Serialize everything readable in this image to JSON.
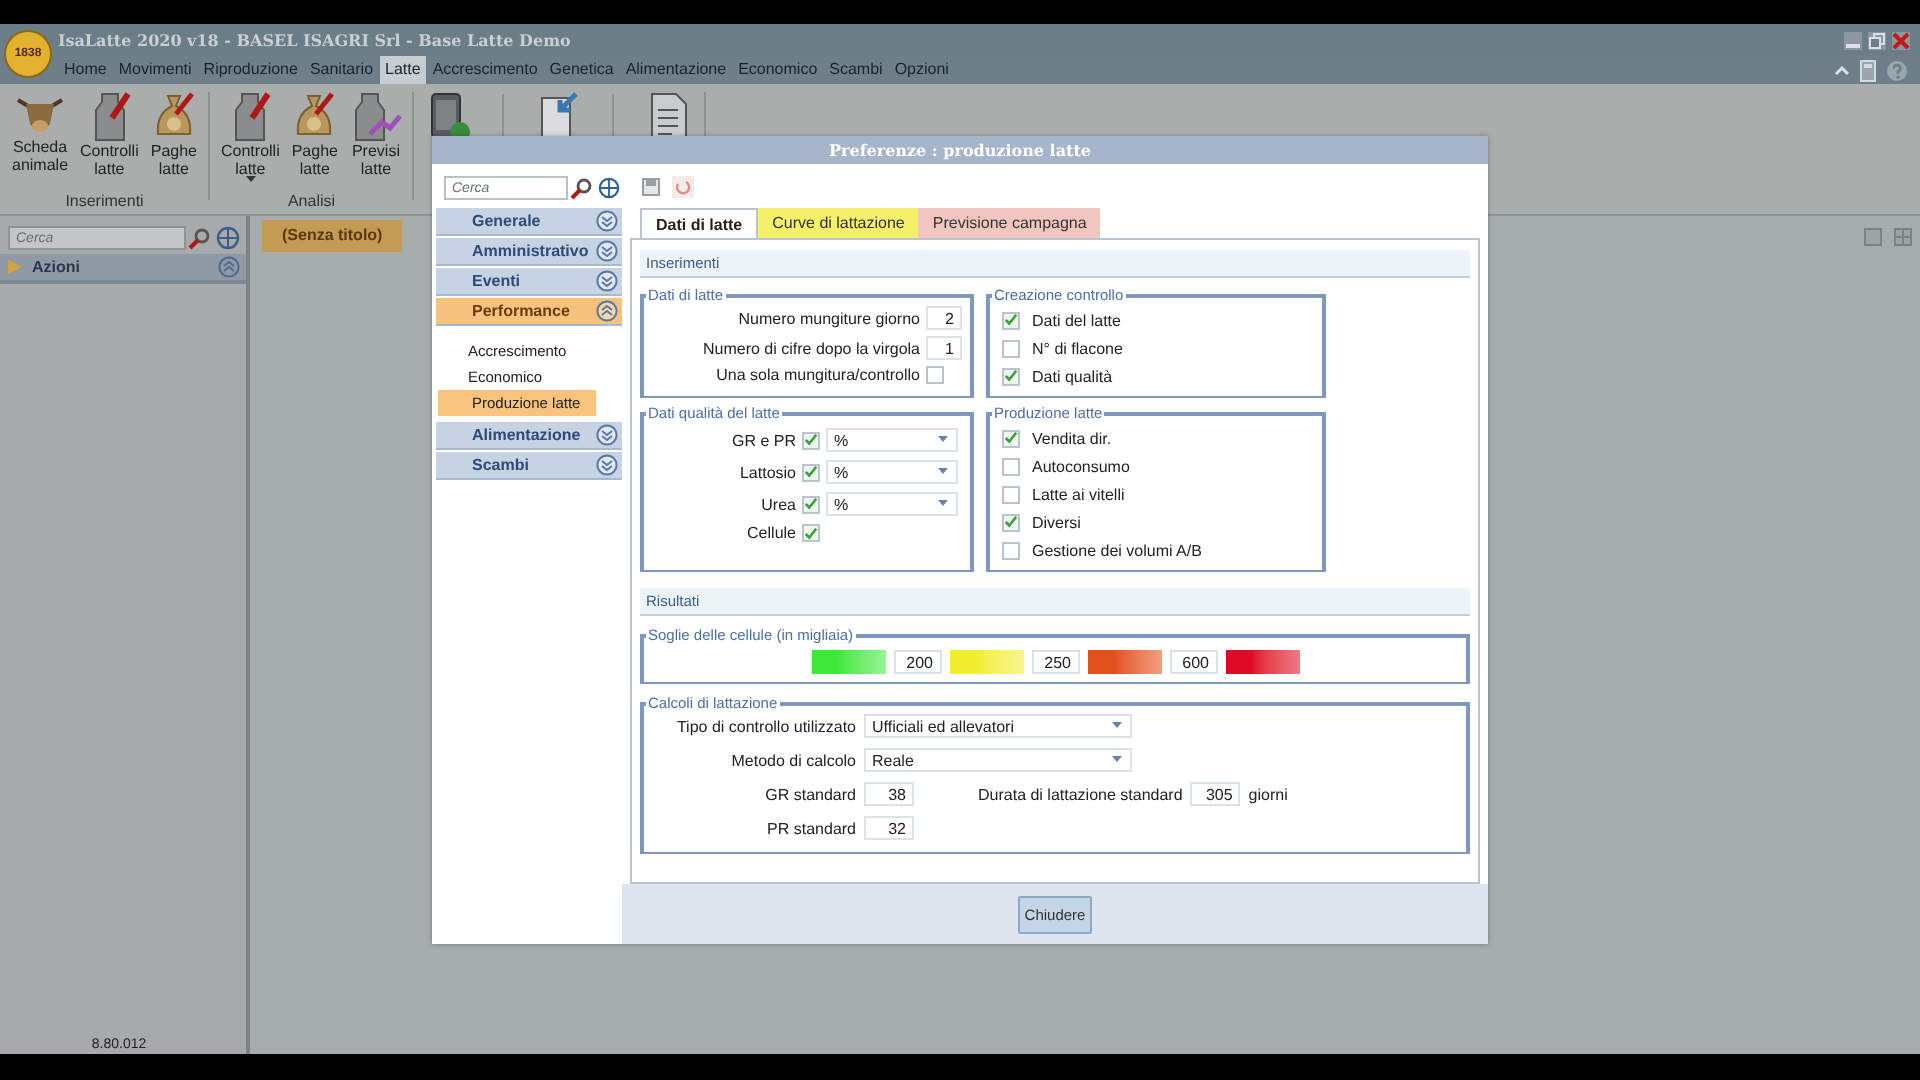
{
  "app": {
    "badge": "1838",
    "title": "IsaLatte 2020 v18 - BASEL ISAGRI Srl - Base Latte Demo"
  },
  "menu": [
    {
      "label": "Home",
      "selected": false
    },
    {
      "label": "Movimenti",
      "selected": false
    },
    {
      "label": "Riproduzione",
      "selected": false
    },
    {
      "label": "Sanitario",
      "selected": false
    },
    {
      "label": "Latte",
      "selected": true
    },
    {
      "label": "Accrescimento",
      "selected": false
    },
    {
      "label": "Genetica",
      "selected": false
    },
    {
      "label": "Alimentazione",
      "selected": false
    },
    {
      "label": "Economico",
      "selected": false
    },
    {
      "label": "Scambi",
      "selected": false
    },
    {
      "label": "Opzioni",
      "selected": false
    }
  ],
  "ribbon": [
    {
      "label": "Inserimenti",
      "buttons": [
        {
          "kind": "cow",
          "label": "Scheda animale"
        },
        {
          "kind": "milk-can",
          "label": "Controlli latte"
        },
        {
          "kind": "money-bag",
          "label": "Paghe latte"
        }
      ]
    },
    {
      "label": "Analisi",
      "buttons": [
        {
          "kind": "milk-can",
          "label": "Controlli latte",
          "dropdown": true
        },
        {
          "kind": "money-bag",
          "label": "Paghe latte"
        },
        {
          "kind": "forecast",
          "label": "Previsi latte"
        }
      ]
    },
    {
      "buttons": [
        {
          "kind": "tablet"
        },
        {
          "kind": "import"
        },
        {
          "kind": "document"
        }
      ]
    }
  ],
  "left_panel": {
    "search_placeholder": "Cerca",
    "section": "Azioni",
    "expanded": true,
    "version": "8.80.012"
  },
  "document_tab": "(Senza titolo)",
  "dialog": {
    "title": "Preferenze : produzione latte",
    "search_placeholder": "Cerca",
    "nav": [
      {
        "label": "Generale",
        "expanded": false,
        "selected": false
      },
      {
        "label": "Amministrativo",
        "expanded": false,
        "selected": false
      },
      {
        "label": "Eventi",
        "expanded": false,
        "selected": false
      },
      {
        "label": "Performance",
        "expanded": true,
        "selected": true,
        "children": [
          {
            "label": "Accrescimento",
            "selected": false
          },
          {
            "label": "Economico",
            "selected": false
          },
          {
            "label": "Produzione latte",
            "selected": true
          }
        ]
      },
      {
        "label": "Alimentazione",
        "expanded": false,
        "selected": false
      },
      {
        "label": "Scambi",
        "expanded": false,
        "selected": false
      }
    ],
    "tabs": [
      {
        "label": "Dati di latte",
        "selected": true,
        "color": "#ffffff"
      },
      {
        "label": "Curve di lattazione",
        "selected": false,
        "color": "#f4f06a"
      },
      {
        "label": "Previsione campagna",
        "selected": false,
        "color": "#f2c6bf"
      }
    ],
    "inserimenti": {
      "title": "Inserimenti",
      "dati_di_latte": {
        "legend": "Dati di latte",
        "fields": [
          {
            "kind": "number",
            "label": "Numero mungiture giorno",
            "value": "2"
          },
          {
            "kind": "number",
            "label": "Numero di cifre dopo la virgola",
            "value": "1"
          },
          {
            "kind": "checkbox",
            "label": "Una sola mungitura/controllo",
            "checked": false
          }
        ]
      },
      "creazione_controllo": {
        "legend": "Creazione controllo",
        "options": [
          {
            "label": "Dati del latte",
            "checked": true
          },
          {
            "label": "N° di flacone",
            "checked": false
          },
          {
            "label": "Dati qualità",
            "checked": true
          }
        ]
      },
      "dati_qualita": {
        "legend": "Dati qualità del latte",
        "rows": [
          {
            "label": "GR e PR",
            "checked": true,
            "unit": "%"
          },
          {
            "label": "Lattosio",
            "checked": true,
            "unit": "%"
          },
          {
            "label": "Urea",
            "checked": true,
            "unit": "%"
          },
          {
            "label": "Cellule",
            "checked": true
          }
        ]
      },
      "produzione_latte": {
        "legend": "Produzione latte",
        "options": [
          {
            "label": "Vendita dir.",
            "checked": true
          },
          {
            "label": "Autoconsumo",
            "checked": false
          },
          {
            "label": "Latte ai vitelli",
            "checked": false
          },
          {
            "label": "Diversi",
            "checked": true
          },
          {
            "label": "Gestione dei volumi A/B",
            "checked": false
          }
        ]
      }
    },
    "risultati": {
      "title": "Risultati",
      "soglie": {
        "legend": "Soglie delle cellule (in migliaia)",
        "levels": [
          {
            "color": "#3ee83a",
            "value": "200"
          },
          {
            "color": "#f2ee2e",
            "value": "250"
          },
          {
            "color": "#e2501c",
            "value": "600"
          },
          {
            "color": "#de0b26"
          }
        ]
      },
      "calcoli": {
        "legend": "Calcoli di lattazione",
        "tipo": {
          "label": "Tipo di controllo utilizzato",
          "value": "Ufficiali ed allevatori"
        },
        "metodo": {
          "label": "Metodo di calcolo",
          "value": "Reale"
        },
        "gr": {
          "label": "GR standard",
          "value": "38"
        },
        "pr": {
          "label": "PR standard",
          "value": "32"
        },
        "durata": {
          "label": "Durata di lattazione standard",
          "value": "305",
          "unit": "giorni"
        }
      }
    },
    "close_button": "Chiudere"
  }
}
